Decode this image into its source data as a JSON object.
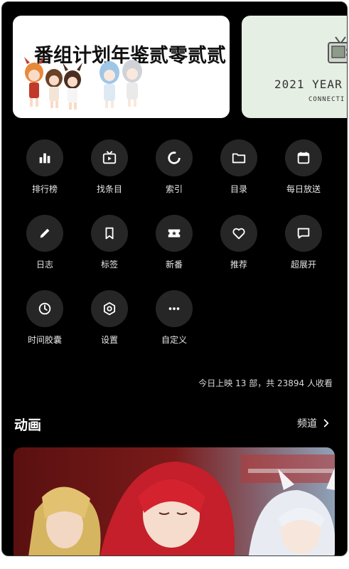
{
  "banners": [
    {
      "title": "番组计划年鉴贰零贰贰"
    },
    {
      "year_text": "2021 YEAR",
      "connect_text": "CONNECTI"
    }
  ],
  "menu": {
    "items": [
      {
        "label": "排行榜",
        "icon": "bar-chart-icon"
      },
      {
        "label": "找条目",
        "icon": "tv-play-icon"
      },
      {
        "label": "索引",
        "icon": "ring-progress-icon"
      },
      {
        "label": "目录",
        "icon": "folder-icon"
      },
      {
        "label": "每日放送",
        "icon": "calendar-icon"
      },
      {
        "label": "日志",
        "icon": "pencil-icon"
      },
      {
        "label": "标签",
        "icon": "bookmark-icon"
      },
      {
        "label": "新番",
        "icon": "ticket-star-icon"
      },
      {
        "label": "推荐",
        "icon": "heart-icon"
      },
      {
        "label": "超展开",
        "icon": "chat-bubble-icon"
      },
      {
        "label": "时间胶囊",
        "icon": "clock-icon"
      },
      {
        "label": "设置",
        "icon": "settings-hex-icon"
      },
      {
        "label": "自定义",
        "icon": "more-dots-icon"
      }
    ]
  },
  "stats": {
    "text": "今日上映 13 部，共 23894 人收看"
  },
  "section": {
    "title": "动画",
    "link_label": "频道"
  },
  "colors": {
    "background": "#000000",
    "circle": "#262626",
    "text": "#e6e6e6"
  }
}
